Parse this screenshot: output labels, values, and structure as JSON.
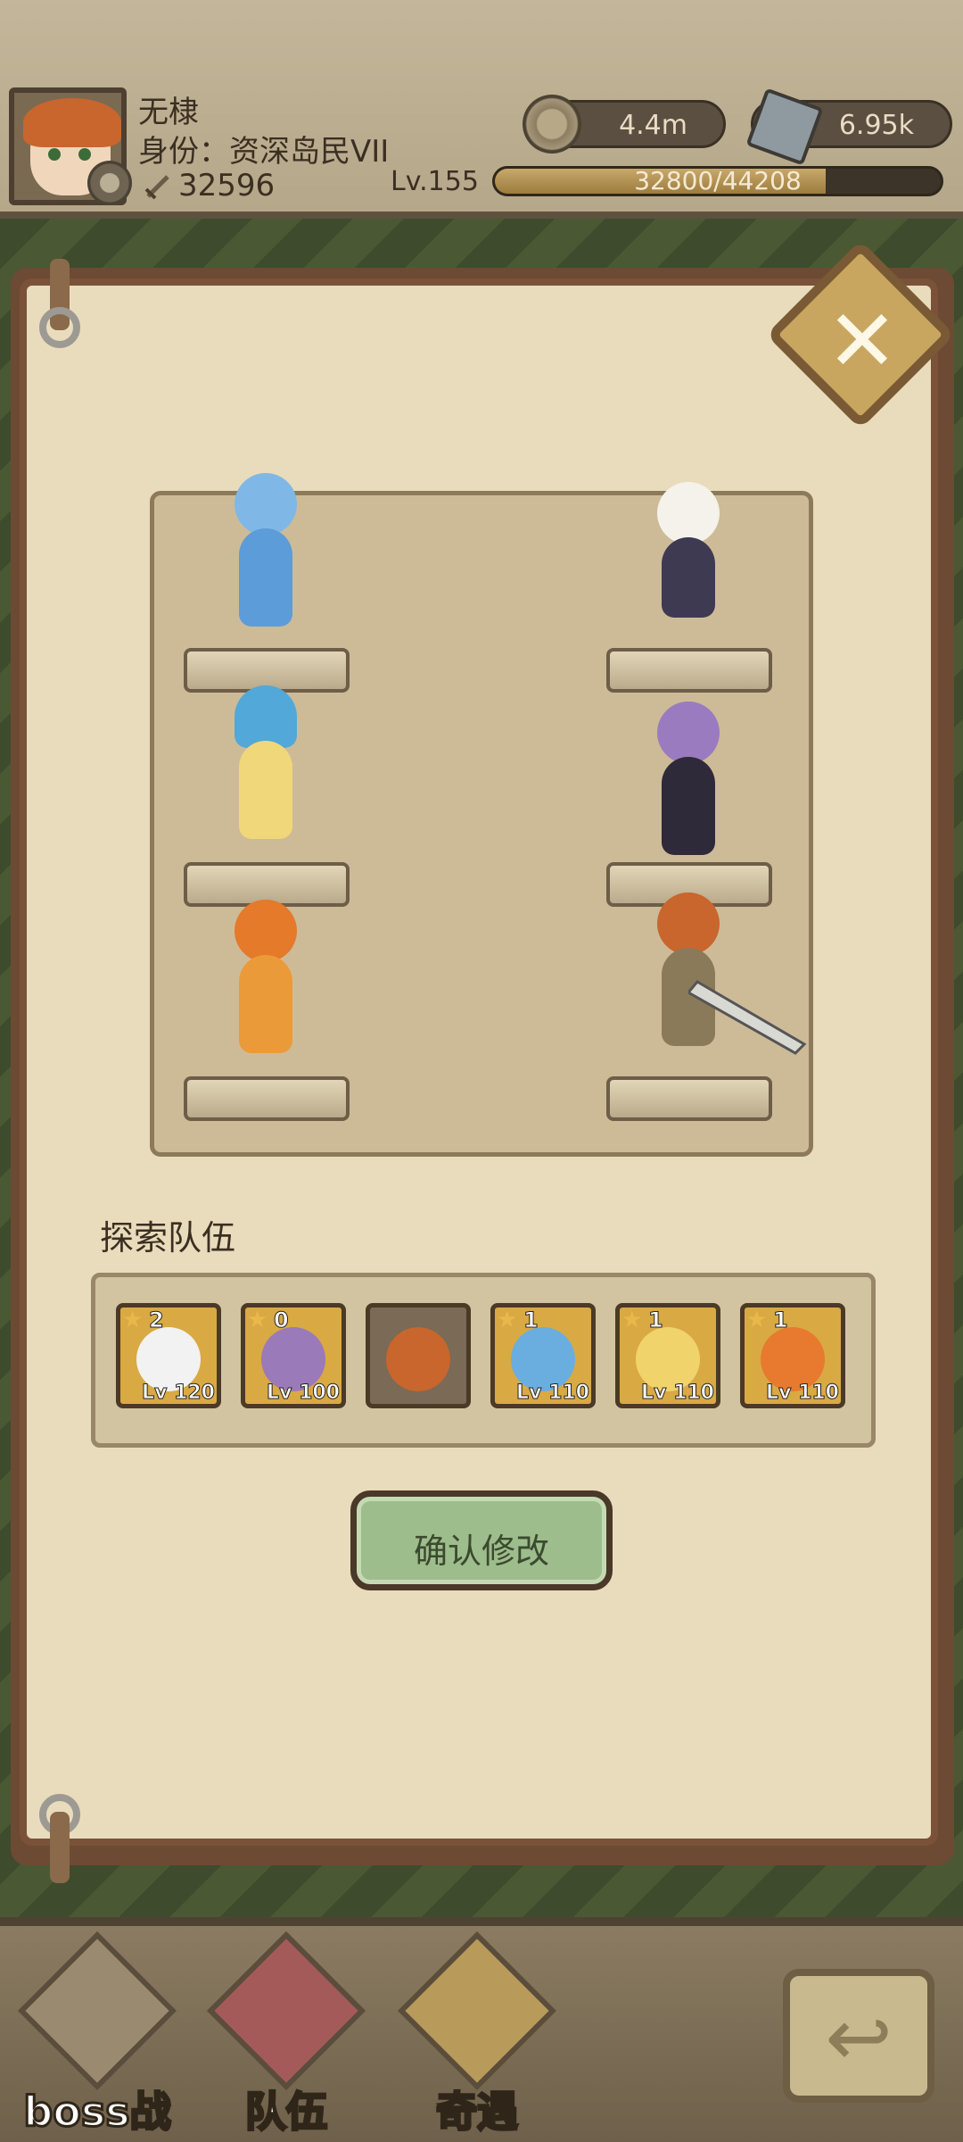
{
  "player": {
    "name": "无棣",
    "title": "身份：资深岛民VII",
    "power": "32596",
    "level": "Lv.155",
    "exp": {
      "current": 32800,
      "max": 44208,
      "text": "32800/44208",
      "fraction": 0.742
    }
  },
  "resources": {
    "coins": {
      "icon": "coin-icon",
      "value": "4.4m"
    },
    "gems": {
      "icon": "gem-icon",
      "value": "6.95k"
    }
  },
  "panel": {
    "close_icon": "close-icon",
    "close_glyph": "✕"
  },
  "formation": {
    "left_column": [
      "blue-slime-girl",
      "mushroom-girl",
      "flame-girl"
    ],
    "right_column": [
      "ghost-knight",
      "octopus-girl",
      "swordsman-hero"
    ]
  },
  "team": {
    "title": "探索队伍",
    "members": [
      {
        "stars": "2",
        "level": "Lv 120",
        "portrait": "ghost",
        "color": "#f2f2f2"
      },
      {
        "stars": "0",
        "level": "Lv 100",
        "portrait": "octopus",
        "color": "#9a7ab8"
      },
      {
        "stars": "",
        "level": "",
        "portrait": "hero",
        "color": "#c8662d"
      },
      {
        "stars": "1",
        "level": "Lv 110",
        "portrait": "slime",
        "color": "#6aaee0"
      },
      {
        "stars": "1",
        "level": "Lv 110",
        "portrait": "mushroom",
        "color": "#f1d36b"
      },
      {
        "stars": "1",
        "level": "Lv 110",
        "portrait": "flame",
        "color": "#e77a2e"
      }
    ]
  },
  "confirm": {
    "label": "确认修改"
  },
  "nav": {
    "items": [
      {
        "label": "boss战",
        "icon": "skull-axe-icon"
      },
      {
        "label": "队伍",
        "icon": "flag-icon"
      },
      {
        "label": "奇遇",
        "icon": "coin-bag-icon"
      }
    ],
    "back_glyph": "↩"
  }
}
